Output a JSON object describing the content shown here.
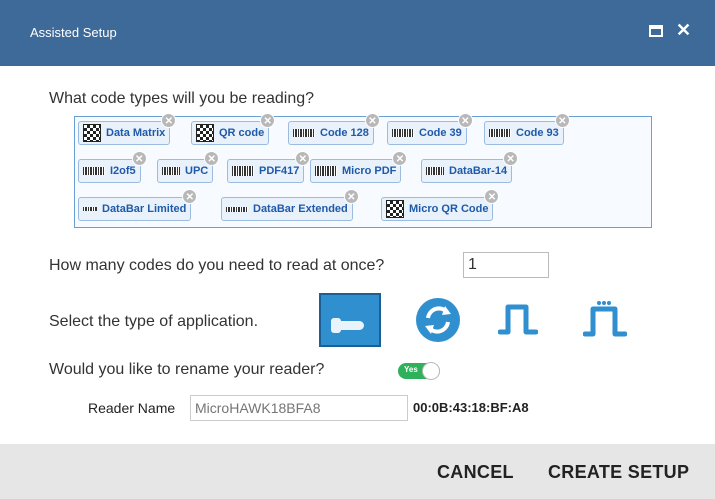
{
  "window": {
    "title": "Assisted Setup"
  },
  "questions": {
    "code_types": "What code types will you be reading?",
    "count": "How many codes do you need to read at once?",
    "app_type": "Select the type of application.",
    "rename": "Would you like to rename your reader?"
  },
  "code_types": [
    {
      "label": "Data Matrix",
      "icon": "datamatrix-icon"
    },
    {
      "label": "QR code",
      "icon": "qr-icon"
    },
    {
      "label": "Code 128",
      "icon": "barcode-icon"
    },
    {
      "label": "Code 39",
      "icon": "barcode-icon"
    },
    {
      "label": "Code 93",
      "icon": "barcode-icon"
    },
    {
      "label": "I2of5",
      "icon": "barcode-icon"
    },
    {
      "label": "UPC",
      "icon": "barcode-icon"
    },
    {
      "label": "PDF417",
      "icon": "pdf417-icon"
    },
    {
      "label": "Micro PDF",
      "icon": "micropdf-icon"
    },
    {
      "label": "DataBar-14",
      "icon": "databar-icon"
    },
    {
      "label": "DataBar Limited",
      "icon": "databar-icon"
    },
    {
      "label": "DataBar Extended",
      "icon": "databar-icon"
    },
    {
      "label": "Micro QR Code",
      "icon": "qr-icon"
    }
  ],
  "count_value": "1",
  "toggle": {
    "label": "Yes",
    "on": true
  },
  "reader": {
    "name_label": "Reader Name",
    "name_placeholder": "MicroHAWK18BFA8",
    "mac": "00:0B:43:18:BF:A8"
  },
  "footer": {
    "cancel": "CANCEL",
    "create": "CREATE SETUP"
  },
  "colors": {
    "titlebar": "#3d6a99",
    "accent": "#2f8fcf",
    "toggle_on": "#2fb05a"
  }
}
